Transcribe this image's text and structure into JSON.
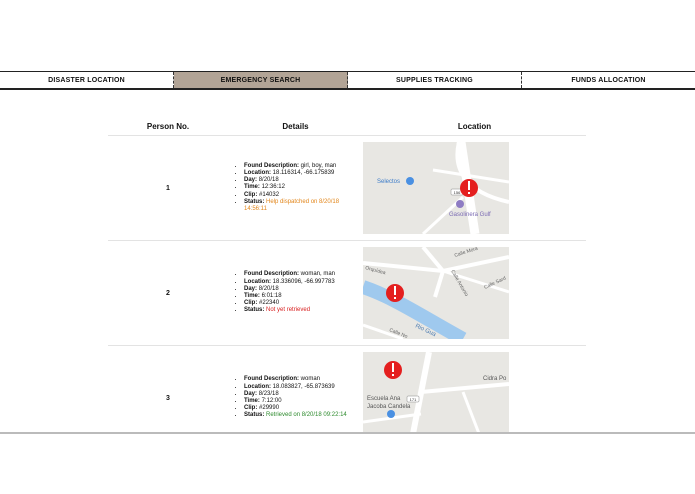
{
  "nav": {
    "tabs": [
      {
        "label": "DISASTER LOCATION",
        "active": false
      },
      {
        "label": "EMERGENCY SEARCH",
        "active": true
      },
      {
        "label": "SUPPLIES TRACKING",
        "active": false
      },
      {
        "label": "FUNDS ALLOCATION",
        "active": false
      }
    ],
    "active_color": "#b2a496"
  },
  "table": {
    "headers": {
      "person": "Person No.",
      "details": "Details",
      "location": "Location"
    },
    "field_labels": {
      "found": "Found Description:",
      "location": "Location:",
      "day": "Day:",
      "time": "Time:",
      "clip": "Clip:",
      "status": "Status:"
    },
    "rows": [
      {
        "number": "1",
        "found": "girl, boy, man",
        "location": "18.116314, -66.175839",
        "day": "8/20/18",
        "time": "12:36:12",
        "clip": "#14032",
        "status": "Help dispatched on 8/20/18 14:56:11",
        "status_color": "#e2861b",
        "map": {
          "labels": [
            "Selectos",
            "Gasolinera Gulf"
          ],
          "badge": "156",
          "marker_icon": "alert-marker-icon"
        }
      },
      {
        "number": "2",
        "found": "woman, man",
        "location": "18.336096, -66.997783",
        "day": "8/20/18",
        "time": "6:01:18",
        "clip": "#22340",
        "status": "Not yet retrieved",
        "status_color": "#d81f1f",
        "map": {
          "labels": [
            "Calle Mora",
            "Calle Antonio",
            "Calle Sard",
            "Rio Gua",
            "Calle No",
            "Orquídea"
          ],
          "marker_icon": "alert-marker-icon"
        }
      },
      {
        "number": "3",
        "found": "woman",
        "location": "18.083827, -65.873639",
        "day": "8/23/18",
        "time": "7:12:00",
        "clip": "#29990",
        "status": "Retrieved on 8/20/18 09:22:14",
        "status_color": "#2e8b2e",
        "map": {
          "labels": [
            "Cidra Po",
            "Escuela Ana",
            "Jacoba Candela"
          ],
          "badge": "171",
          "marker_icon": "alert-marker-icon"
        }
      }
    ]
  }
}
